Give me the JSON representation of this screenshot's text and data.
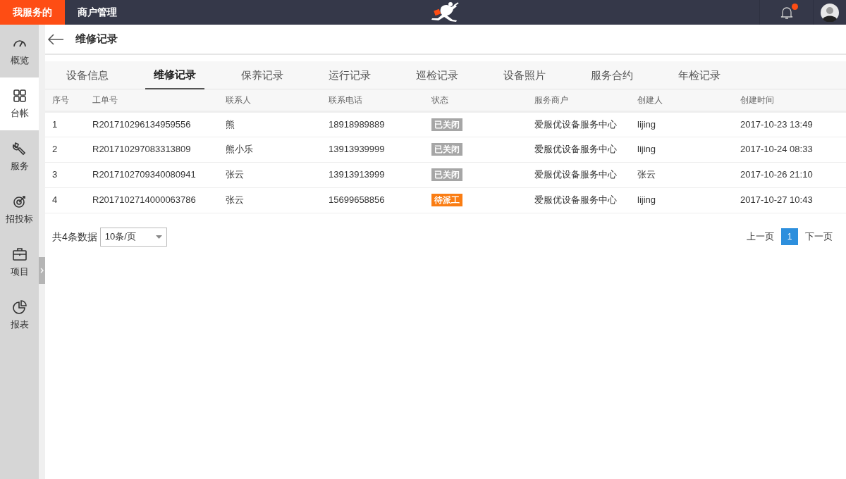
{
  "topbar": {
    "tabs": [
      {
        "label": "我服务的",
        "selected": true
      },
      {
        "label": "商户管理",
        "selected": false
      }
    ],
    "notification": {
      "unread": true
    }
  },
  "sidebar": {
    "items": [
      {
        "label": "概览",
        "selected": false
      },
      {
        "label": "台帐",
        "selected": true
      },
      {
        "label": "服务",
        "selected": false
      },
      {
        "label": "招投标",
        "selected": false
      },
      {
        "label": "项目",
        "selected": false
      },
      {
        "label": "报表",
        "selected": false
      }
    ]
  },
  "header": {
    "title": "维修记录"
  },
  "tabs": [
    {
      "label": "设备信息",
      "selected": false
    },
    {
      "label": "维修记录",
      "selected": true
    },
    {
      "label": "保养记录",
      "selected": false
    },
    {
      "label": "运行记录",
      "selected": false
    },
    {
      "label": "巡检记录",
      "selected": false
    },
    {
      "label": "设备照片",
      "selected": false
    },
    {
      "label": "服务合约",
      "selected": false
    },
    {
      "label": "年检记录",
      "selected": false
    }
  ],
  "table": {
    "columns": [
      "序号",
      "工单号",
      "联系人",
      "联系电话",
      "状态",
      "服务商户",
      "创建人",
      "创建时间"
    ],
    "rows": [
      {
        "cells": [
          "1",
          "R201710296134959556",
          "熊",
          "18918989889"
        ],
        "status": {
          "label": "已关闭",
          "color": "#a6a6a6"
        },
        "rest": [
          "爱服优设备服务中心",
          "lijing",
          "2017-10-23 13:49"
        ]
      },
      {
        "cells": [
          "2",
          "R201710297083313809",
          "熊小乐",
          "13913939999"
        ],
        "status": {
          "label": "已关闭",
          "color": "#a6a6a6"
        },
        "rest": [
          "爱服优设备服务中心",
          "lijing",
          "2017-10-24 08:33"
        ]
      },
      {
        "cells": [
          "3",
          "R2017102709340080941",
          "张云",
          "13913913999"
        ],
        "status": {
          "label": "已关闭",
          "color": "#a6a6a6"
        },
        "rest": [
          "爱服优设备服务中心",
          "张云",
          "2017-10-26 21:10"
        ]
      },
      {
        "cells": [
          "4",
          "R2017102714000063786",
          "张云",
          "15699658856"
        ],
        "status": {
          "label": "待派工",
          "color": "#fa7d13"
        },
        "rest": [
          "爱服优设备服务中心",
          "lijing",
          "2017-10-27 10:43"
        ]
      }
    ]
  },
  "footer": {
    "total": "共4条数据",
    "page_size": "10条/页",
    "prev": "上一页",
    "pages": [
      {
        "label": "1",
        "selected": true
      }
    ],
    "next": "下一页"
  }
}
